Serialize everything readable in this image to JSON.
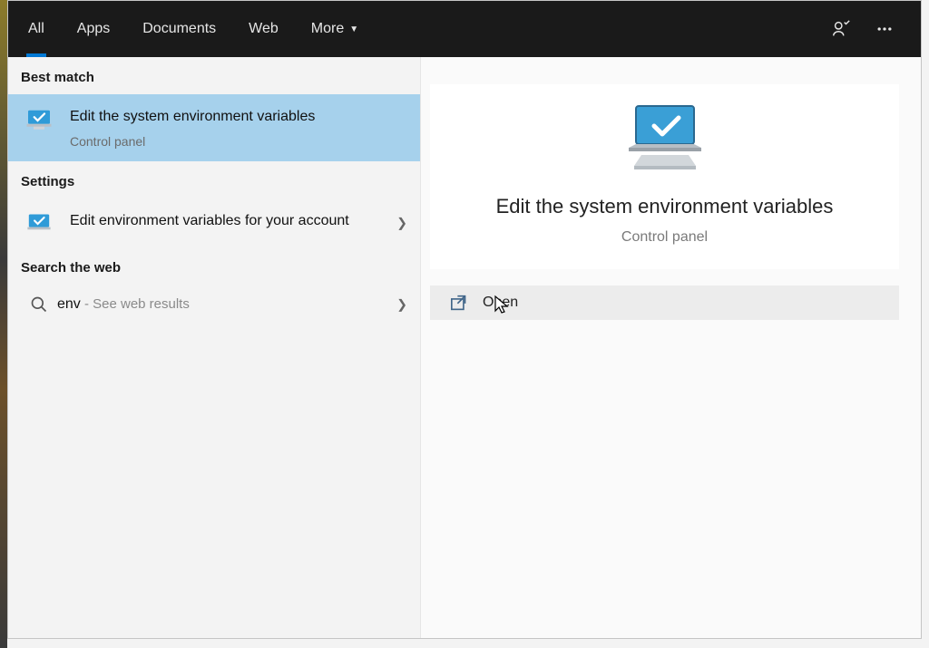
{
  "tabs": {
    "all": "All",
    "apps": "Apps",
    "documents": "Documents",
    "web": "Web",
    "more": "More"
  },
  "sections": {
    "best_match": "Best match",
    "settings": "Settings",
    "search_web": "Search the web"
  },
  "results": {
    "best": {
      "title": "Edit the system environment variables",
      "subtitle": "Control panel"
    },
    "settings_item": {
      "title": "Edit environment variables for your account"
    },
    "web_item": {
      "query": "env",
      "suffix": " - See web results"
    }
  },
  "preview": {
    "title": "Edit the system environment variables",
    "subtitle": "Control panel",
    "open_label": "Open"
  }
}
